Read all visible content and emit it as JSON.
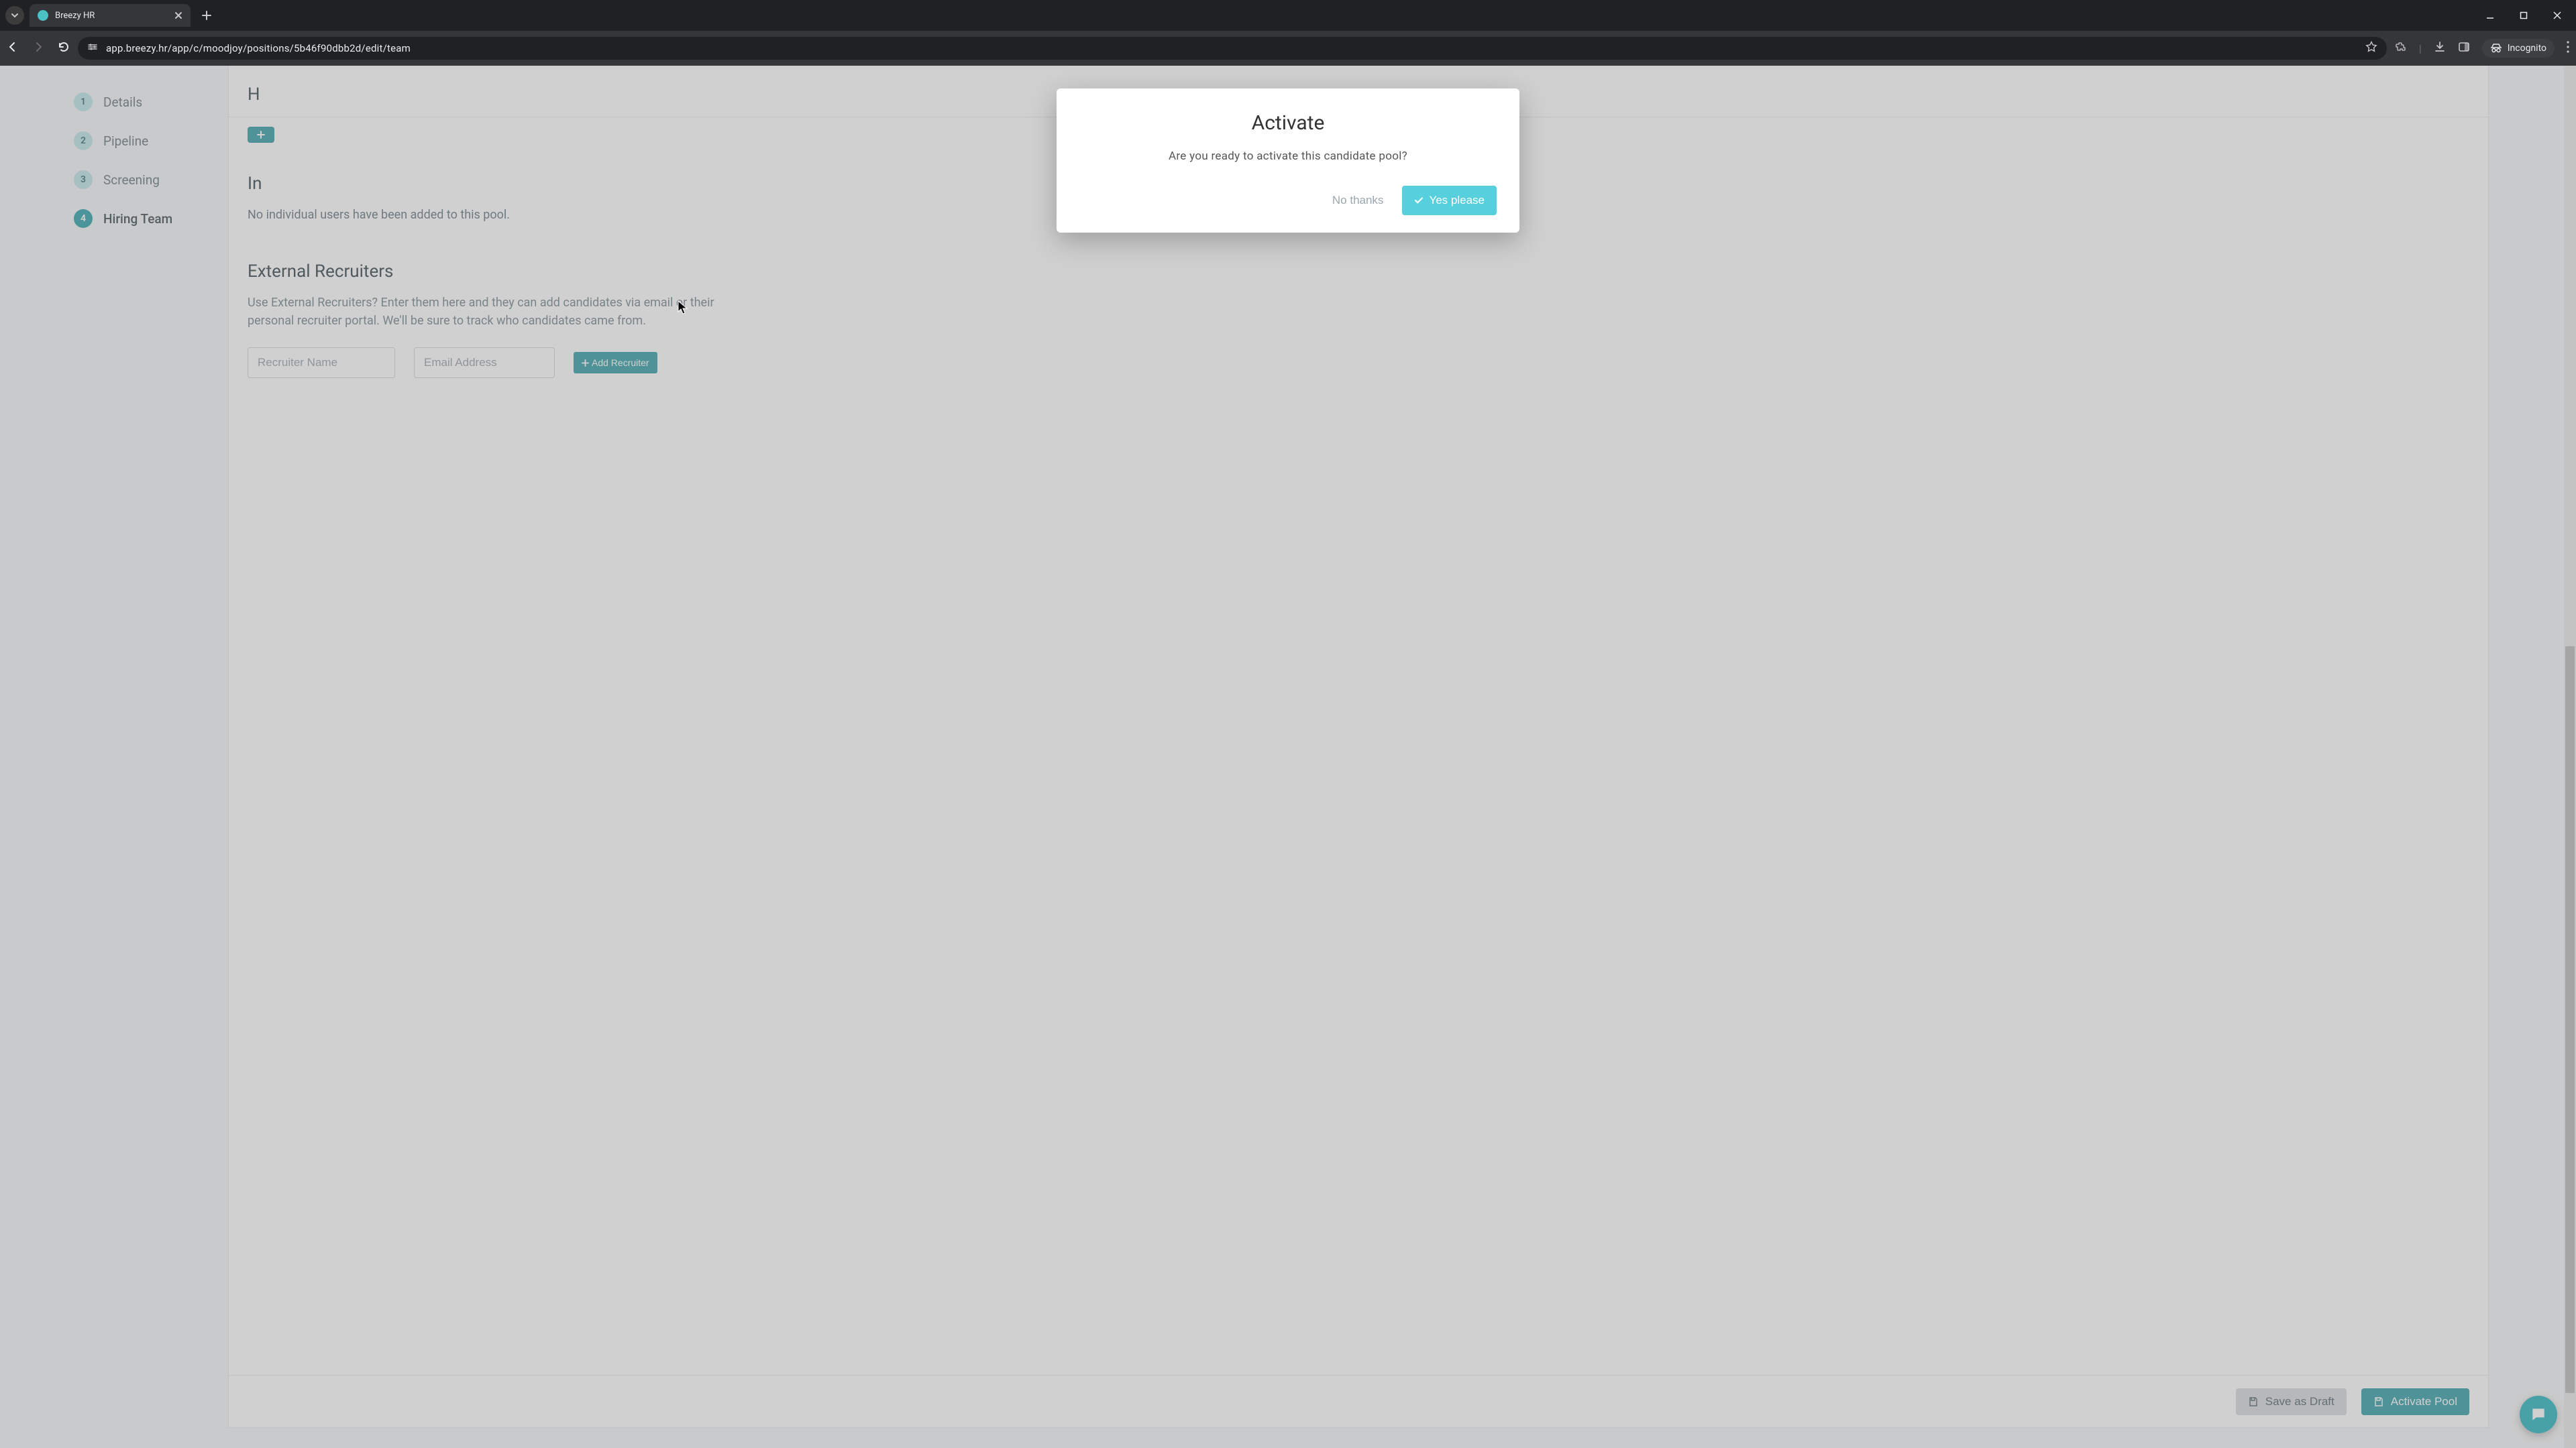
{
  "browser": {
    "tab_title": "Breezy HR",
    "url": "app.breezy.hr/app/c/moodjoy/positions/5b46f90dbb2d/edit/team",
    "incognito_label": "Incognito"
  },
  "sidebar": {
    "steps": [
      {
        "num": "1",
        "label": "Details"
      },
      {
        "num": "2",
        "label": "Pipeline"
      },
      {
        "num": "3",
        "label": "Screening"
      },
      {
        "num": "4",
        "label": "Hiring Team"
      }
    ],
    "active_index": 3
  },
  "page_content": {
    "hiring_team_title_partial": "H",
    "individual_title_partial": "In",
    "individual_empty_text": "No individual users have been added to this pool.",
    "external_recruiters_title": "External Recruiters",
    "external_recruiters_hint": "Use External Recruiters? Enter them here and they can add candidates via email or their personal recruiter portal. We'll be sure to track who candidates came from.",
    "recruiter_name_placeholder": "Recruiter Name",
    "recruiter_email_placeholder": "Email Address",
    "add_recruiter_label": "Add Recruiter"
  },
  "footer": {
    "save_draft_label": "Save as Draft",
    "activate_pool_label": "Activate Pool"
  },
  "modal": {
    "title": "Activate",
    "body": "Are you ready to activate this candidate pool?",
    "cancel_label": "No thanks",
    "confirm_label": "Yes please"
  },
  "colors": {
    "accent": "#3aa0a8",
    "accent_light": "#55d0dc"
  }
}
